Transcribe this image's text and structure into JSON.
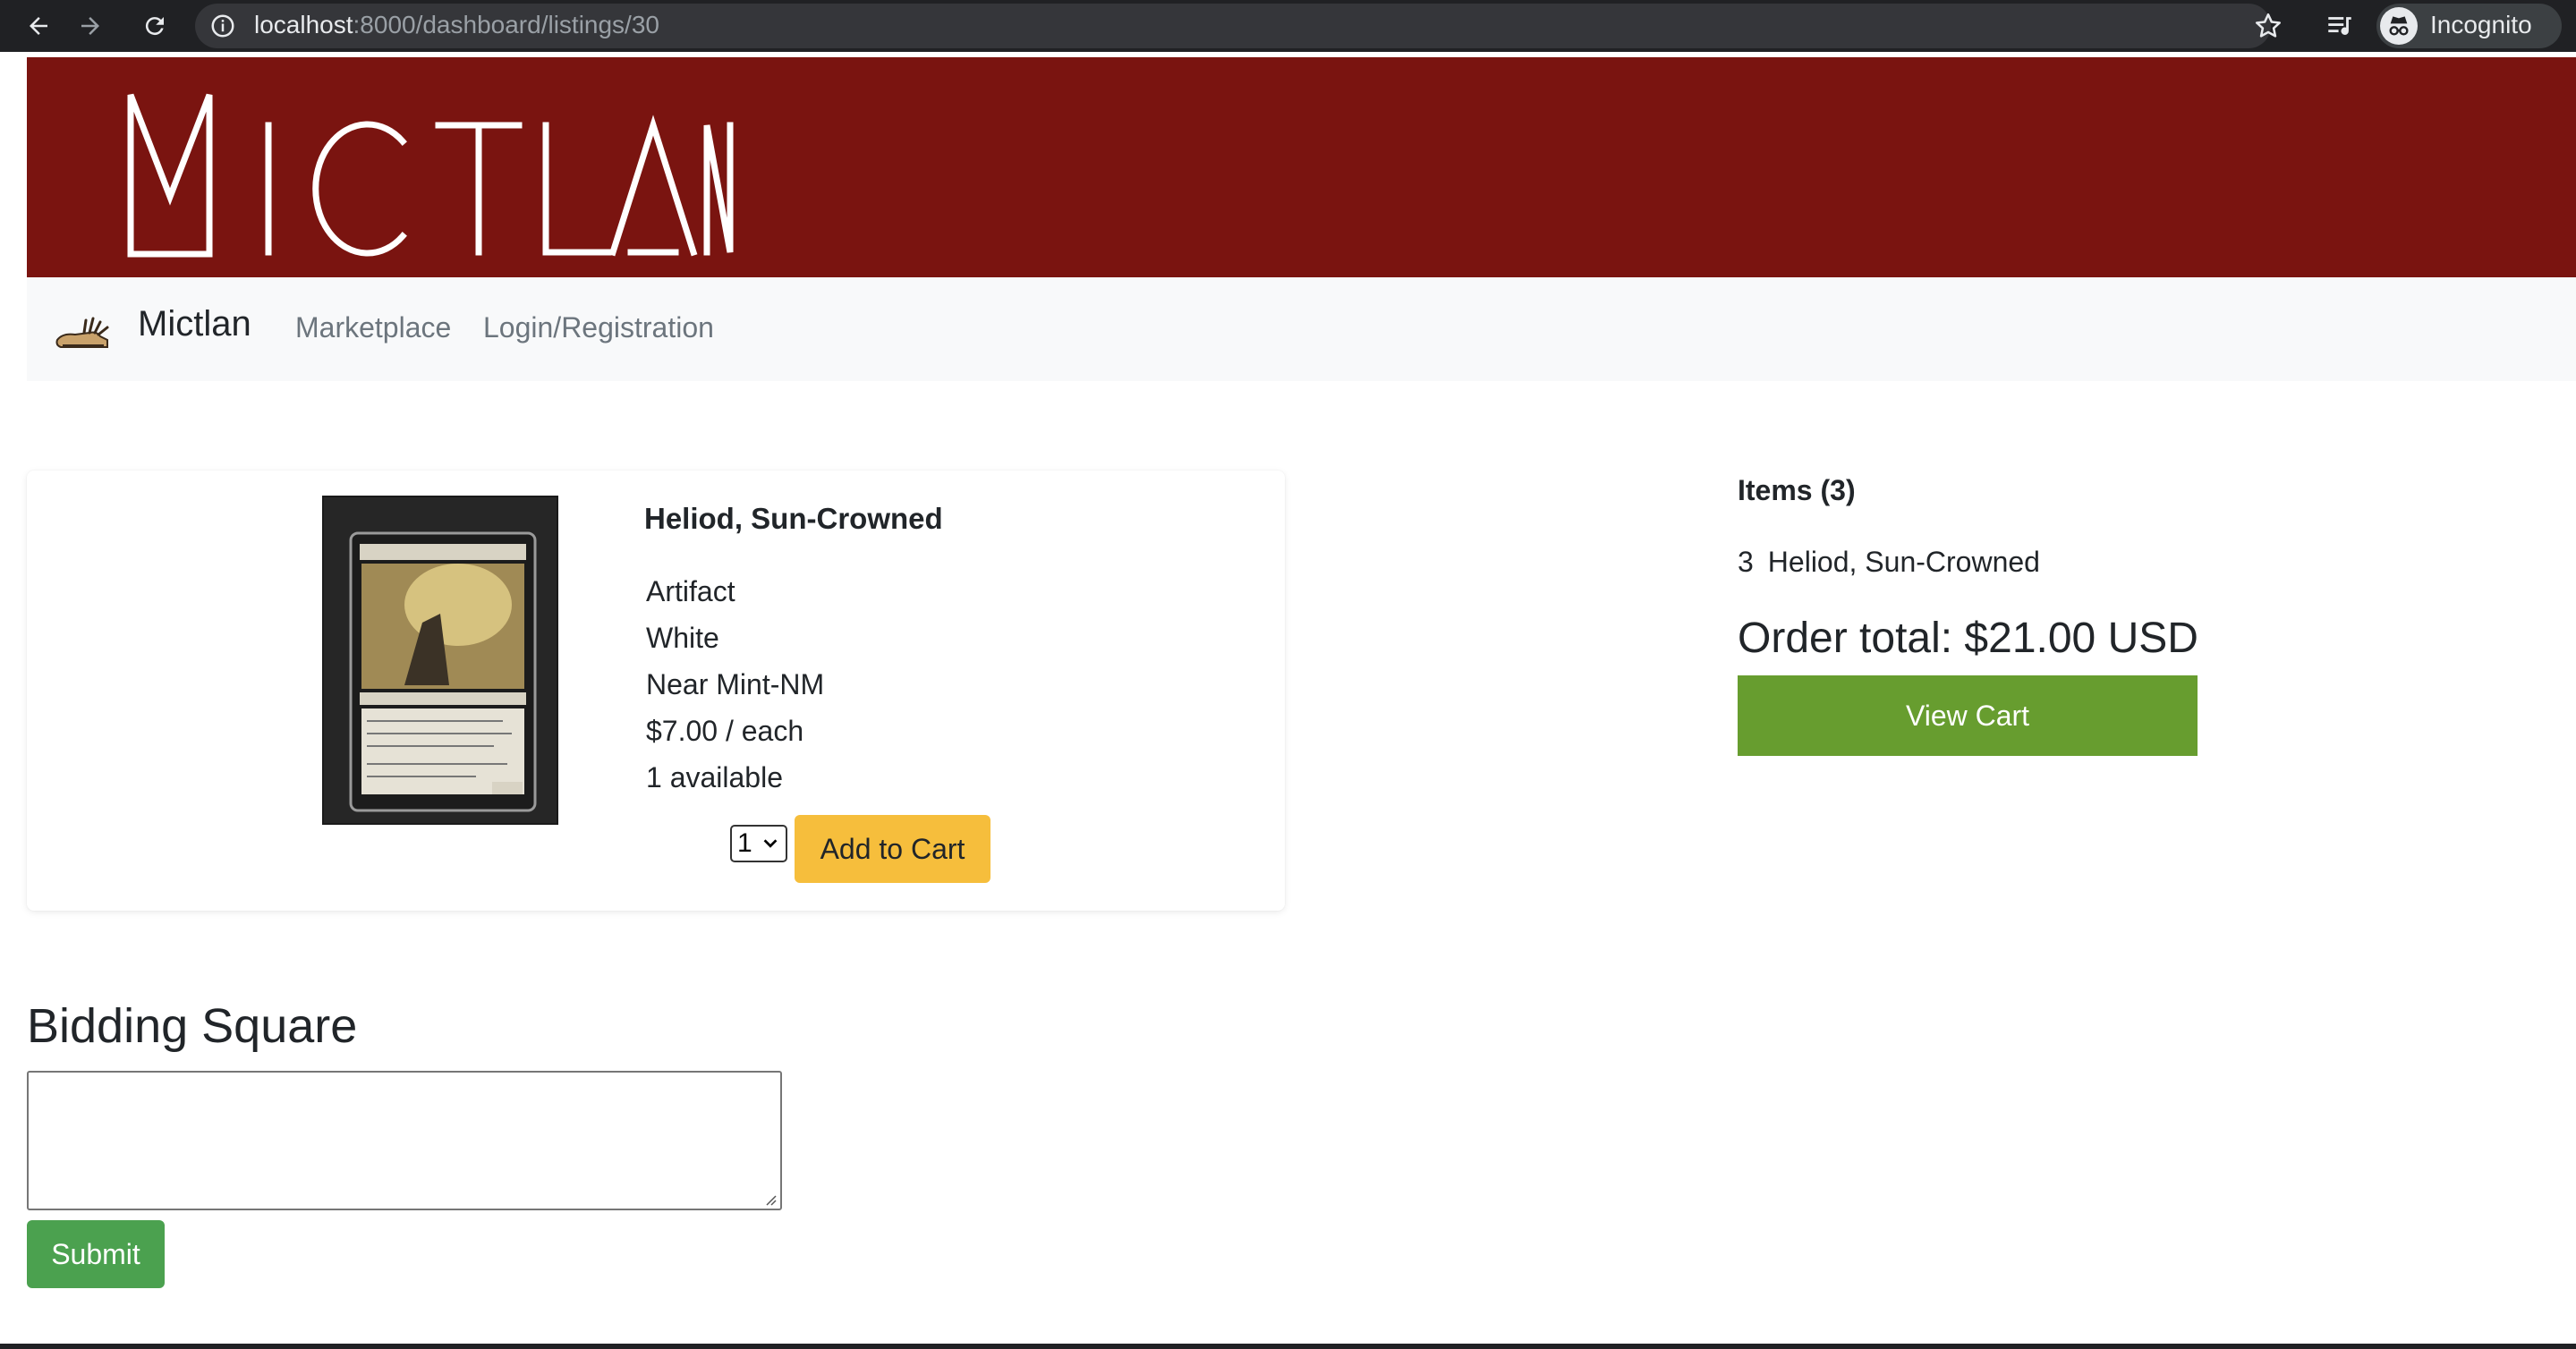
{
  "browser": {
    "url_host": "localhost",
    "url_rest": ":8000/dashboard/listings/30",
    "profile_label": "Incognito"
  },
  "banner": {
    "logo_text": "MICTLAN",
    "background": "#7a1410"
  },
  "navbar": {
    "brand": "Mictlan",
    "links": [
      "Marketplace",
      "Login/Registration"
    ]
  },
  "listing": {
    "title": "Heliod, Sun-Crowned",
    "type": "Artifact",
    "color": "White",
    "condition": "Near Mint-NM",
    "price": "$7.00 / each",
    "availability": "1 available",
    "quantity_selected": "1",
    "add_to_cart_label": "Add to Cart",
    "add_button_color": "#f6be3c"
  },
  "cart": {
    "items_heading": "Items (3)",
    "lines": [
      {
        "qty": "3",
        "name": "Heliod, Sun-Crowned"
      }
    ],
    "order_total": "Order total: $21.00 USD",
    "view_cart_label": "View Cart",
    "view_cart_color": "#679d2f"
  },
  "bidding": {
    "title": "Bidding Square",
    "input_value": "",
    "submit_label": "Submit",
    "submit_color": "#4ba14f"
  },
  "icons": [
    "back-arrow-icon",
    "forward-arrow-icon",
    "reload-icon",
    "info-icon",
    "star-icon",
    "media-control-icon",
    "incognito-icon",
    "brand-hand-icon",
    "chevron-down-icon"
  ]
}
